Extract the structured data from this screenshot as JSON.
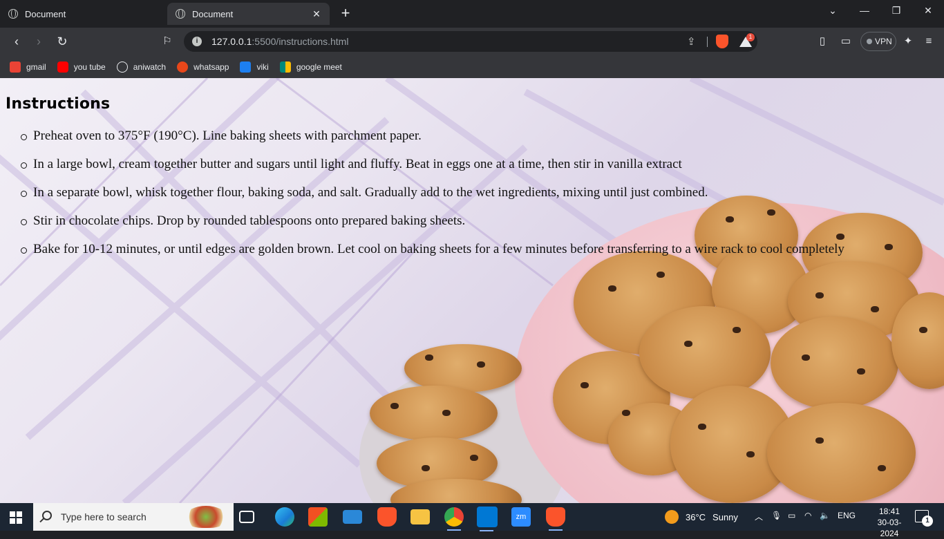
{
  "browser": {
    "tabs": [
      {
        "label": "Document",
        "active": false
      },
      {
        "label": "Document",
        "active": true
      }
    ],
    "address": {
      "host": "127.0.0.1",
      "rest": ":5500/instructions.html"
    },
    "brave_badge": "1",
    "vpn_label": "VPN",
    "bookmarks": [
      {
        "label": "gmail",
        "icon": "gmail-icon",
        "color": "#ea4335"
      },
      {
        "label": "you tube",
        "icon": "youtube-icon",
        "color": "#ff0000"
      },
      {
        "label": "aniwatch",
        "icon": "aniwatch-icon",
        "color": "#e8eaed"
      },
      {
        "label": "whatsapp",
        "icon": "whatsapp-icon",
        "color": "#e8471a"
      },
      {
        "label": "viki",
        "icon": "viki-icon",
        "color": "#1d7ff0"
      },
      {
        "label": "google meet",
        "icon": "google-meet-icon",
        "color": "#00897b"
      }
    ]
  },
  "page": {
    "title": "Instructions",
    "steps": [
      "Preheat oven to 375°F (190°C). Line baking sheets with parchment paper.",
      "In a large bowl, cream together butter and sugars until light and fluffy. Beat in eggs one at a time, then stir in vanilla extract",
      "In a separate bowl, whisk together flour, baking soda, and salt. Gradually add to the wet ingredients, mixing until just combined.",
      "Stir in chocolate chips. Drop by rounded tablespoons onto prepared baking sheets.",
      "Bake for 10-12 minutes, or until edges are golden brown. Let cool on baking sheets for a few minutes before transferring to a wire rack to cool completely"
    ]
  },
  "taskbar": {
    "search_placeholder": "Type here to search",
    "weather": {
      "temp": "36°C",
      "condition": "Sunny"
    },
    "language": "ENG",
    "time": "18:41",
    "date": "30-03-2024",
    "notification_count": "1",
    "colors": {
      "accent": "#8ab4f8",
      "background": "#1c2633"
    }
  }
}
